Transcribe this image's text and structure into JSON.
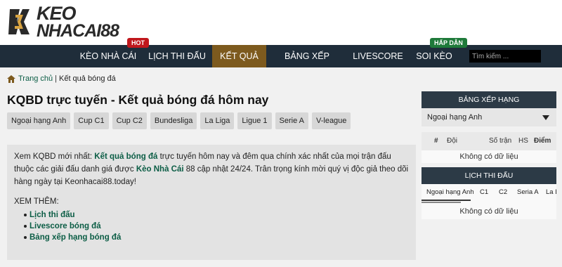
{
  "logo": {
    "line1": "KEO",
    "line2": "NHACAI",
    "num": "88"
  },
  "nav": {
    "items": [
      "KÈO NHÀ CÁI",
      "LỊCH THI ĐẤU",
      "KẾT QUẢ",
      "BẢNG XẾP HẠNG",
      "LIVESCORE",
      "SOI KÈO"
    ],
    "active_index": 2,
    "badges": {
      "hot": "HOT",
      "hap_dan": "HẤP DẪN"
    },
    "search_placeholder": "Tìm kiếm ..."
  },
  "breadcrumb": {
    "home": "Trang chủ",
    "sep": "|",
    "current": "Kết quả bóng đá"
  },
  "page_title": "KQBD trực tuyến - Kết quả bóng đá hôm nay",
  "league_tabs": [
    "Ngoại hạng Anh",
    "Cup C1",
    "Cup C2",
    "Bundesliga",
    "La Liga",
    "Ligue 1",
    "Serie A",
    "V-league"
  ],
  "content": {
    "p1_a": "Xem KQBD mới nhất: ",
    "p1_b": "Kết quả bóng đá",
    "p1_c": " trực tuyến hôm nay và đêm qua chính xác nhất của mọi trận đấu thuộc các giải đấu danh giá được ",
    "p1_d": "Kèo Nhà Cái",
    "p1_e": " 88 cập nhật 24/24. Trân trọng kính mời quý vị độc giả theo dõi hàng ngày tại Keonhacai88.today!",
    "see_more": "XEM THÊM:",
    "links": [
      "Lịch thi đấu",
      "Livescore bóng đá",
      "Bảng xếp hạng bóng đá"
    ]
  },
  "sidebar": {
    "standings_title": "BẢNG XẾP HẠNG",
    "league_select": "Ngoại hạng Anh",
    "columns": [
      "#",
      "Đội",
      "Số trận",
      "HS",
      "Điểm"
    ],
    "empty": "Không có dữ liệu",
    "schedule_title": "LỊCH THI ĐẤU",
    "schedule_tabs": [
      "Ngoại hạng Anh",
      "C1",
      "C2",
      "Seria A",
      "La L"
    ],
    "schedule_empty": "Không có dữ liệu"
  },
  "colors": {
    "nav_bg": "#1f2d3a",
    "active": "#7d5a1e",
    "link_green": "#0b5d45",
    "hot": "#c0171c",
    "hap_dan": "#1f7a3a"
  }
}
